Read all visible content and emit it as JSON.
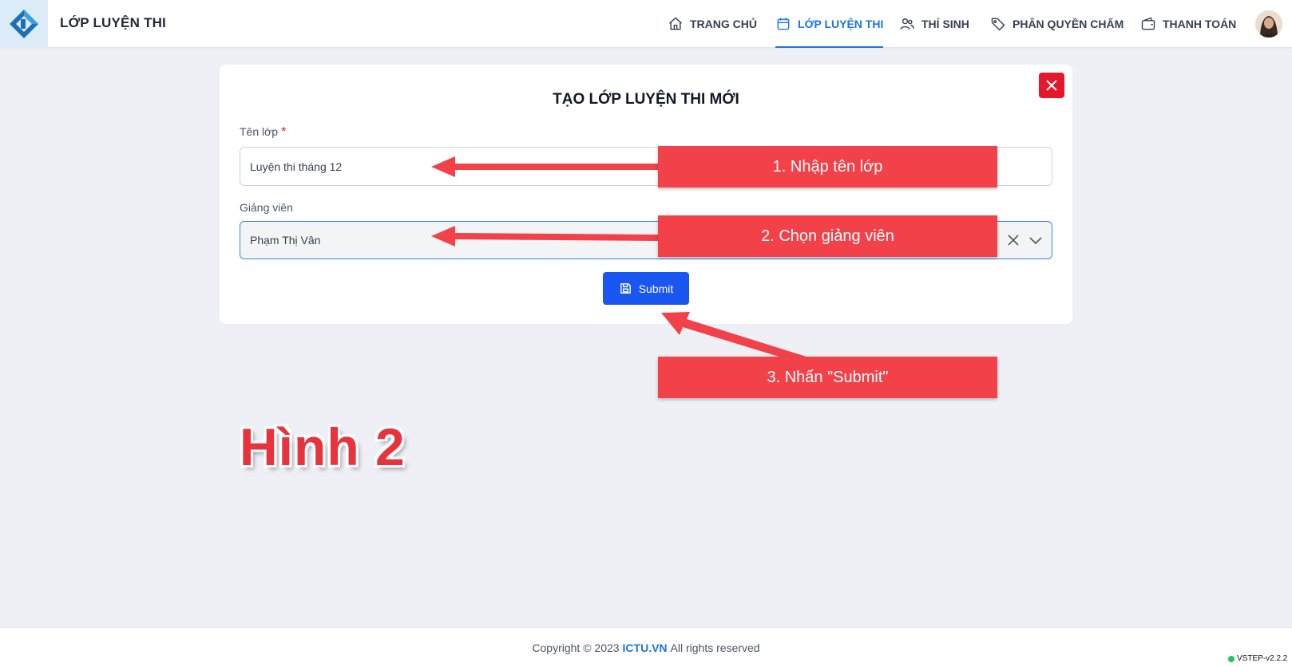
{
  "header": {
    "app_title": "LỚP LUYỆN THI",
    "nav": [
      {
        "label": "TRANG CHỦ",
        "icon": "home-icon"
      },
      {
        "label": "LỚP LUYỆN THI",
        "icon": "calendar-icon",
        "active": true
      },
      {
        "label": "THÍ SINH",
        "icon": "users-icon"
      },
      {
        "label": "PHÂN QUYỀN CHẤM",
        "icon": "tag-icon"
      },
      {
        "label": "THANH TOÁN",
        "icon": "wallet-icon"
      }
    ],
    "accent_color": "#1b74e4"
  },
  "form": {
    "title": "TẠO LỚP LUYỆN THI MỚI",
    "class_name_label": "Tên lớp",
    "required_mark": "*",
    "class_name_value": "Luyện thi tháng 12",
    "teacher_label": "Giảng viên",
    "teacher_value": "Phạm Thị Vân",
    "submit_label": "Submit"
  },
  "annotations": {
    "step1": "1. Nhập tên lớp",
    "step2": "2. Chọn giảng viên",
    "step3": "3. Nhấn \"Submit\"",
    "figure_label": "Hình 2",
    "callout_color": "#f24149"
  },
  "footer": {
    "prefix": "Copyright © 2023",
    "brand": "ICTU.VN",
    "suffix": "All rights reserved",
    "version": "VSTEP-v2.2.2"
  }
}
